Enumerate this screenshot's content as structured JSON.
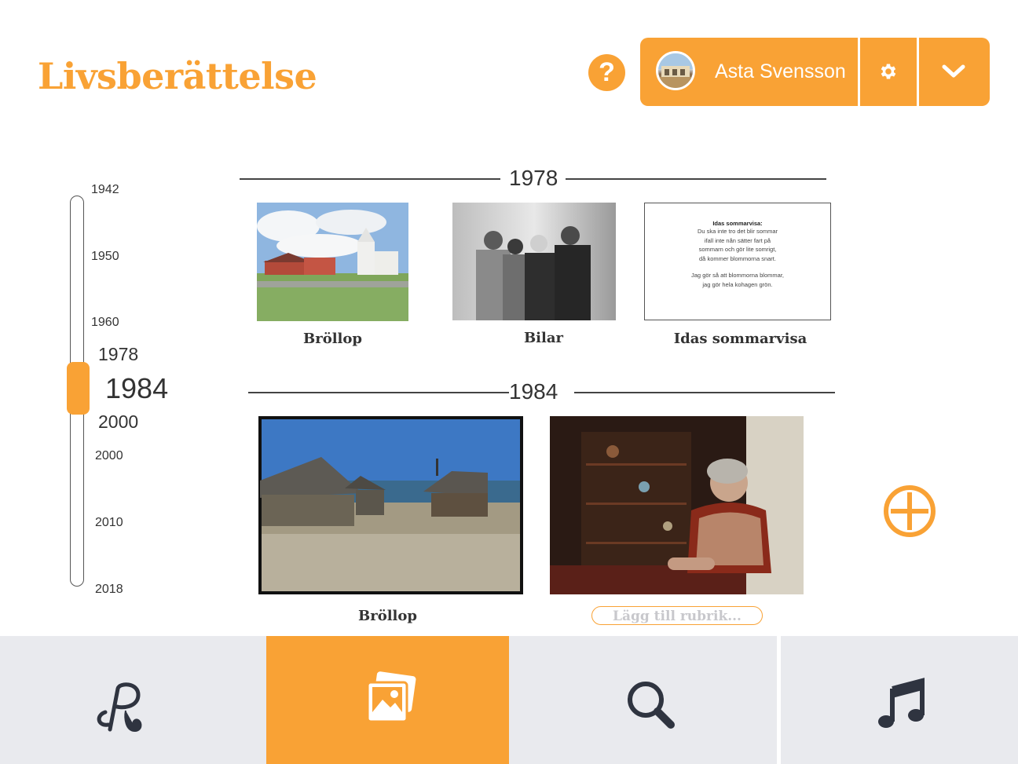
{
  "header": {
    "title": "Livsberättelse",
    "help_label": "?",
    "user_name": "Asta Svensson"
  },
  "timeline": {
    "ticks": [
      "1942",
      "1950",
      "1960",
      "2000",
      "2010",
      "2018"
    ],
    "prev_year": "1978",
    "current_year": "1984",
    "next_year": "2000",
    "handle_level": 0.43
  },
  "sections": [
    {
      "year": "1978",
      "items": [
        {
          "caption": "Bröllop",
          "kind": "photo"
        },
        {
          "caption": "Bilar",
          "kind": "photo"
        },
        {
          "caption": "Idas sommarvisa",
          "kind": "text",
          "text_title": "Idas sommarvisa:",
          "text_lines": [
            "Du ska inte tro det blir sommar",
            "ifall inte nån sätter fart på",
            "sommarn och gör lite somrigt,",
            "då kommer blommorna snart."
          ],
          "text_lines2": [
            "Jag gör så att blommorna blommar,",
            "jag gör hela kohagen grön."
          ]
        }
      ]
    },
    {
      "year": "1984",
      "items": [
        {
          "caption": "Bröllop",
          "kind": "photo"
        },
        {
          "caption": "",
          "placeholder": "Lägg till rubrik...",
          "kind": "photo"
        }
      ]
    }
  ],
  "bottom_nav": [
    {
      "icon": "p-monogram-icon",
      "active": false
    },
    {
      "icon": "photos-icon",
      "active": true
    },
    {
      "icon": "search-icon",
      "active": false
    },
    {
      "icon": "music-icon",
      "active": false
    }
  ],
  "colors": {
    "accent": "#f9a235",
    "nav_bg": "#e9eaee",
    "icon_dark": "#2f3440"
  }
}
